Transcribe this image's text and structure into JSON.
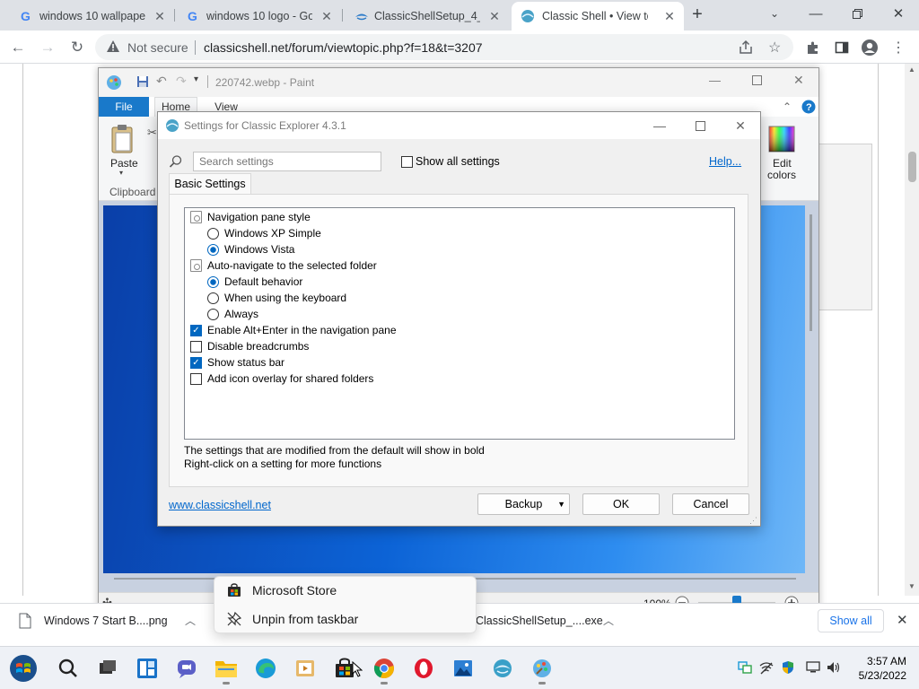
{
  "browser": {
    "tabs": [
      {
        "title": "windows 10 wallpaper",
        "icon": "google-icon"
      },
      {
        "title": "windows 10 logo - Goo",
        "icon": "google-icon"
      },
      {
        "title": "ClassicShellSetup_4_3_",
        "icon": "shell-icon"
      },
      {
        "title": "Classic Shell • View top",
        "icon": "shell-icon",
        "active": true
      }
    ],
    "new_tab_symbol": "+",
    "security_label": "Not secure",
    "url": "classicshell.net/forum/viewtopic.php?f=18&t=3207"
  },
  "paint": {
    "title": "220742.webp - Paint",
    "tabs": {
      "file": "File",
      "home": "Home",
      "view": "View"
    },
    "paste_label": "Paste",
    "clipboard_label": "Clipboard",
    "edit_colors_line1": "Edit",
    "edit_colors_line2": "colors",
    "zoom_level": "100%",
    "zoom_fraction": 0.5
  },
  "dialog": {
    "title": "Settings for Classic Explorer 4.3.1",
    "search_placeholder": "Search settings",
    "show_all_label": "Show all settings",
    "help_link": "Help...",
    "tab_basic": "Basic Settings",
    "settings": [
      {
        "kind": "group",
        "label": "Navigation pane style"
      },
      {
        "kind": "radio",
        "label": "Windows XP Simple",
        "checked": false
      },
      {
        "kind": "radio",
        "label": "Windows Vista",
        "checked": true
      },
      {
        "kind": "group",
        "label": "Auto-navigate to the selected folder"
      },
      {
        "kind": "radio",
        "label": "Default behavior",
        "checked": true
      },
      {
        "kind": "radio",
        "label": "When using the keyboard",
        "checked": false
      },
      {
        "kind": "radio",
        "label": "Always",
        "checked": false
      },
      {
        "kind": "checkbox",
        "label": "Enable Alt+Enter in the navigation pane",
        "checked": true
      },
      {
        "kind": "checkbox",
        "label": "Disable breadcrumbs",
        "checked": false
      },
      {
        "kind": "checkbox",
        "label": "Show status bar",
        "checked": true
      },
      {
        "kind": "checkbox",
        "label": "Add icon overlay for shared folders",
        "checked": false
      }
    ],
    "hint_line1": "The settings that are modified from the default will show in bold",
    "hint_line2": "Right-click on a setting for more functions",
    "website_link": "www.classicshell.net",
    "backup_label": "Backup",
    "ok_label": "OK",
    "cancel_label": "Cancel"
  },
  "downloads": {
    "item1": "Windows 7 Start B....png",
    "item2": "ClassicShellSetup_....exe",
    "show_all": "Show all"
  },
  "jumplist": {
    "items": [
      {
        "label": "Microsoft Store",
        "icon": "store-icon"
      },
      {
        "label": "Unpin from taskbar",
        "icon": "unpin-icon"
      }
    ]
  },
  "taskbar": {
    "apps": [
      "start-icon",
      "search-icon",
      "task-view-icon",
      "widgets-icon",
      "teams-chat-icon",
      "file-explorer-icon",
      "edge-icon",
      "video-editor-icon",
      "microsoft-store-icon",
      "chrome-icon",
      "opera-icon",
      "photos-icon",
      "classic-shell-icon",
      "paint-icon"
    ],
    "time": "3:57 AM",
    "date": "5/23/2022"
  },
  "colors": {
    "accent": "#0067c0",
    "paint_file_tab": "#1979ca",
    "link": "#0066cc"
  }
}
